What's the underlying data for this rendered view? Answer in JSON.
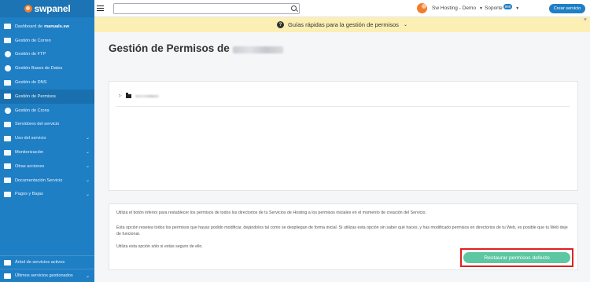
{
  "brand": {
    "name": "swpanel"
  },
  "sidebar": {
    "items": [
      {
        "label": "Dashboard de",
        "bold": "manuals.sw",
        "icon": "dashboard-icon"
      },
      {
        "label": "Gestión de Correo",
        "icon": "mail-icon"
      },
      {
        "label": "Gestión de FTP",
        "icon": "ftp-icon"
      },
      {
        "label": "Gestión Bases de Datos",
        "icon": "database-icon"
      },
      {
        "label": "Gestión de DNS",
        "icon": "dns-flag-icon"
      },
      {
        "label": "Gestión de Permisos",
        "icon": "permissions-icon"
      },
      {
        "label": "Gestión de Crons",
        "icon": "cron-icon"
      },
      {
        "label": "Servidores del servicio",
        "icon": "servers-icon"
      },
      {
        "label": "Uso del servicio",
        "icon": "usage-icon",
        "chevron": "⌄"
      },
      {
        "label": "Monitorización",
        "icon": "monitoring-icon",
        "chevron": "⌄"
      },
      {
        "label": "Otras acciones",
        "icon": "actions-icon",
        "chevron": "⌄"
      },
      {
        "label": "Documentación Servicio",
        "icon": "docs-icon",
        "chevron": "⌄"
      },
      {
        "label": "Pagos y Bajas",
        "icon": "payments-icon",
        "chevron": "⌄"
      }
    ],
    "bottom": [
      {
        "label": "Árbol de servicios activos",
        "icon": "tree-icon"
      },
      {
        "label": "Últimos servicios gestionados",
        "icon": "recent-icon",
        "chevron": "⌄"
      }
    ]
  },
  "topbar": {
    "search_placeholder": "",
    "account": "Sw Hosting - Demo",
    "support": "Soporte",
    "support_badge": "999",
    "create_button": "Crear servicio"
  },
  "guide": {
    "text": "Guías rápidas para la gestión de permisos",
    "close": "×"
  },
  "main": {
    "title": "Gestión de Permisos de",
    "info": {
      "p1": "Utiliza el botón inferior para restablecer los permisos de todos los directorios de tu Servicios de Hosting a los permisos iniciales en el momento de creación del Servicio.",
      "p2": "Esta opción resetea todos los permisos que hayas podido modificar, dejándolos tal como se despliegan de forma inicial. Si utilizas esta opción sin saber qué haces, y has modificado permisos en directorios de tu Web, es posible que tu Web deje de funcionar.",
      "p3": "Utiliza esta opción sólo si estás seguro de ello.",
      "restore_button": "Restaurar permisos defecto"
    }
  },
  "colors": {
    "sidebar": "#1f7fc5",
    "guide_bg": "#fcefb4",
    "restore": "#5cc7a1",
    "highlight": "#e02020",
    "brand_orange": "#f07d2e"
  }
}
